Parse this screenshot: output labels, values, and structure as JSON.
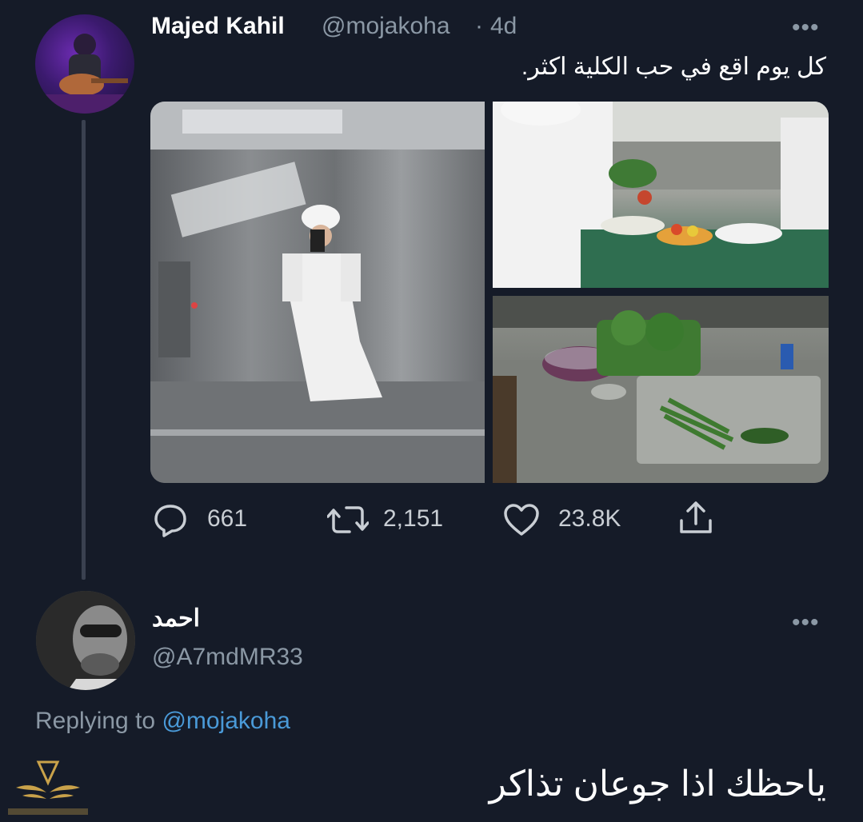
{
  "tweet": {
    "author_name": "Majed Kahil",
    "author_handle": "@mojakoha",
    "separator": "·",
    "time": "4d",
    "more": "•••",
    "text": "كل يوم اقع في حب الكلية اكثر.",
    "actions": {
      "reply_count": "661",
      "retweet_count": "2,151",
      "like_count": "23.8K"
    },
    "icons": [
      "reply-icon",
      "retweet-icon",
      "like-icon",
      "share-icon"
    ]
  },
  "reply": {
    "author_name": "احمد",
    "author_handle": "@A7mdMR33",
    "more": "•••",
    "replying_prefix": "Replying to",
    "replying_mention": "@mojakoha",
    "text": "ياحظك اذا جوعان تذاكر"
  },
  "colors": {
    "background": "#151b28",
    "text_primary": "#ffffff",
    "text_secondary": "#8b98a5",
    "mention": "#4a9ad8"
  }
}
